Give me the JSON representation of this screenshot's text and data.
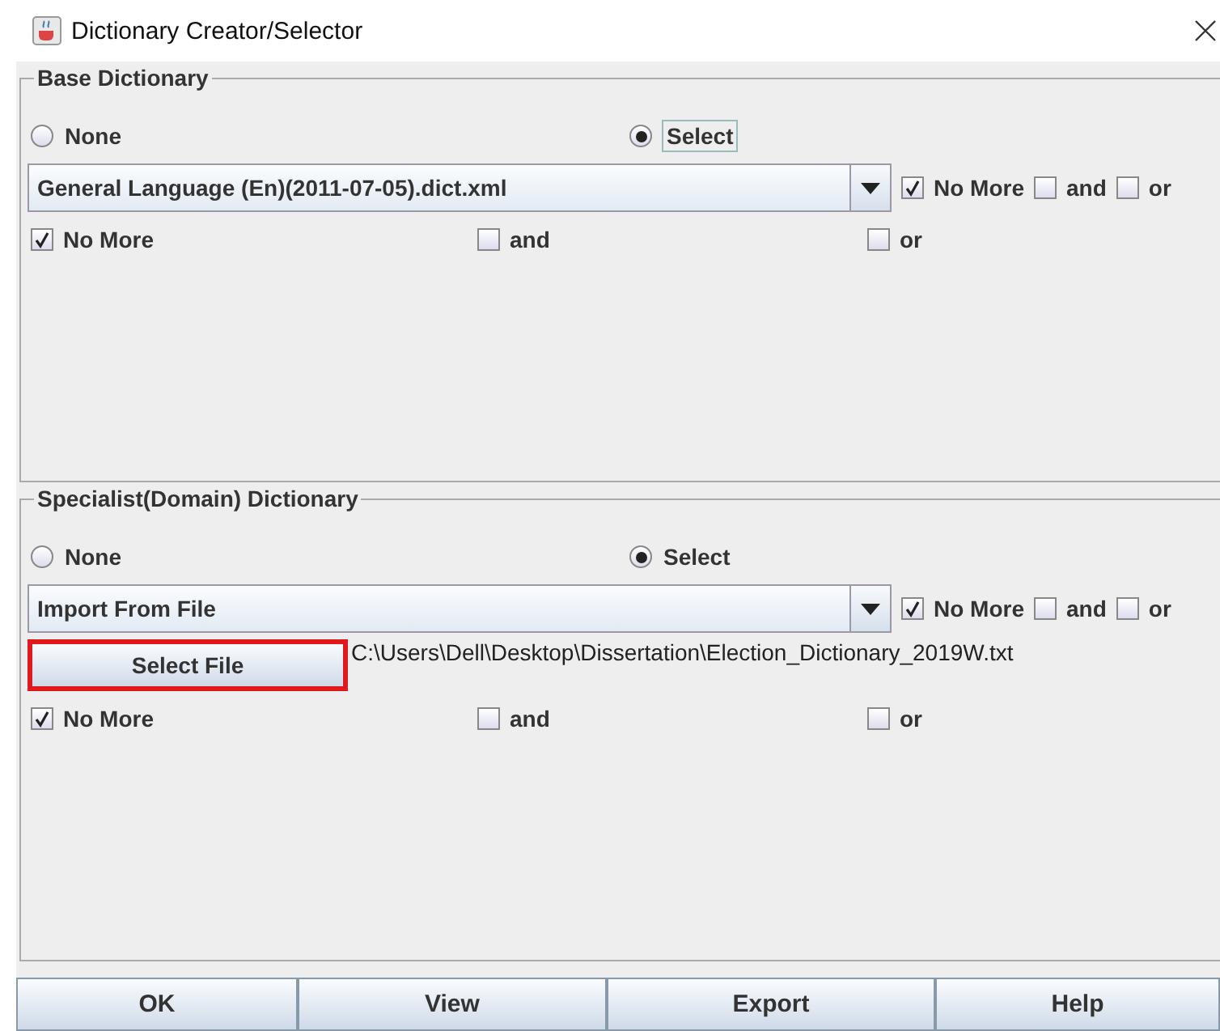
{
  "window": {
    "title": "Dictionary Creator/Selector"
  },
  "panels": [
    {
      "title": "Base Dictionary",
      "radios": [
        {
          "label": "None",
          "selected": false,
          "focused": false
        },
        {
          "label": "Select",
          "selected": true,
          "focused": true
        }
      ],
      "combo": {
        "value": "General Language (En)(2011-07-05).dict.xml"
      },
      "inline_checks": [
        {
          "label": "No More",
          "checked": true
        },
        {
          "label": "and",
          "checked": false
        },
        {
          "label": "or",
          "checked": false
        }
      ],
      "checks": [
        {
          "label": "No More",
          "checked": true
        },
        {
          "label": "and",
          "checked": false
        },
        {
          "label": "or",
          "checked": false
        }
      ]
    },
    {
      "title": "Specialist(Domain) Dictionary",
      "radios": [
        {
          "label": "None",
          "selected": false,
          "focused": false
        },
        {
          "label": "Select",
          "selected": true,
          "focused": false
        }
      ],
      "combo": {
        "value": "Import From File"
      },
      "inline_checks": [
        {
          "label": "No More",
          "checked": true
        },
        {
          "label": "and",
          "checked": false
        },
        {
          "label": "or",
          "checked": false
        }
      ],
      "file": {
        "button": "Select File",
        "path": "C:\\Users\\Dell\\Desktop\\Dissertation\\Election_Dictionary_2019W.txt",
        "highlighted": true
      },
      "checks": [
        {
          "label": "No More",
          "checked": true
        },
        {
          "label": "and",
          "checked": false
        },
        {
          "label": "or",
          "checked": false
        }
      ]
    }
  ],
  "buttons": [
    "OK",
    "View",
    "Export",
    "Help"
  ]
}
